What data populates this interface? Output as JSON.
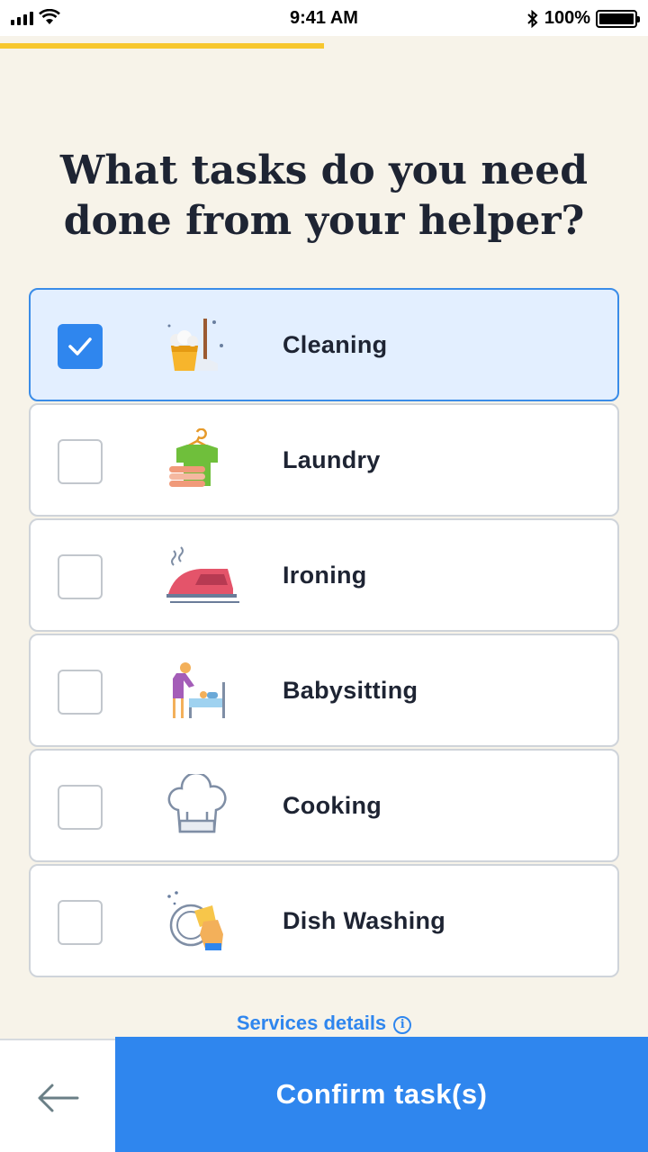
{
  "status_bar": {
    "time": "9:41 AM",
    "battery": "100%",
    "icons": [
      "signal-icon",
      "wifi-icon",
      "bluetooth-icon",
      "battery-icon"
    ]
  },
  "progress": {
    "fraction": 0.5,
    "color": "#f7c72e"
  },
  "title": "What tasks do you need\ndone from your helper?",
  "tasks": [
    {
      "label": "Cleaning",
      "icon": "cleaning-bucket-mop-icon",
      "checked": true
    },
    {
      "label": "Laundry",
      "icon": "laundry-shirt-towels-icon",
      "checked": false
    },
    {
      "label": "Ironing",
      "icon": "iron-icon",
      "checked": false
    },
    {
      "label": "Babysitting",
      "icon": "babysitting-icon",
      "checked": false
    },
    {
      "label": "Cooking",
      "icon": "chef-hat-icon",
      "checked": false
    },
    {
      "label": "Dish Washing",
      "icon": "dish-washing-icon",
      "checked": false
    }
  ],
  "services_link": {
    "label": "Services details",
    "icon": "info-icon"
  },
  "footer": {
    "back_icon": "arrow-left-icon",
    "confirm_label": "Confirm task(s)"
  },
  "colors": {
    "background": "#f7f3e9",
    "accent": "#2f86ee",
    "selected_card": "#e3efff",
    "progress": "#f7c72e"
  }
}
